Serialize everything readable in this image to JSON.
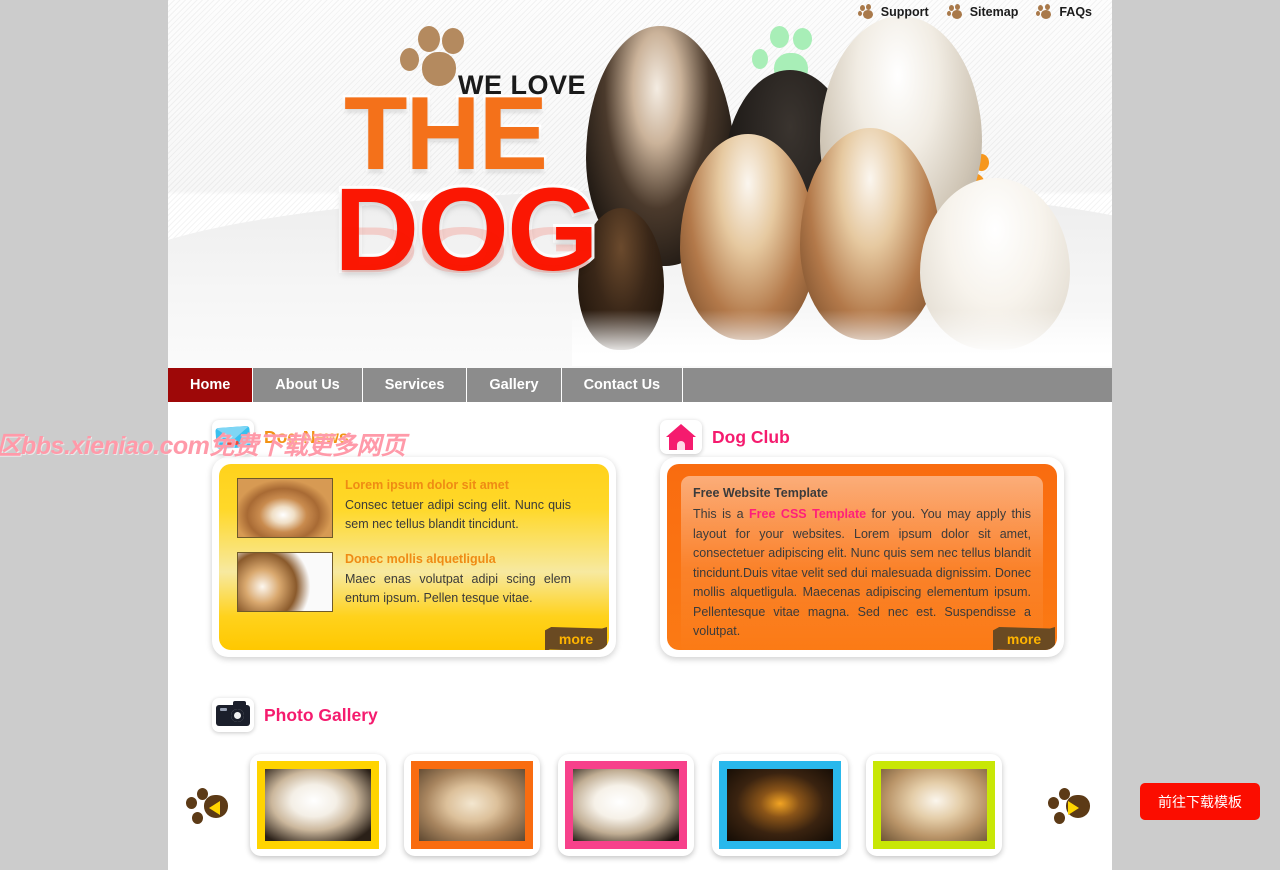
{
  "top_links": [
    {
      "label": "Support",
      "icon": "paw-icon"
    },
    {
      "label": "Sitemap",
      "icon": "paw-icon"
    },
    {
      "label": "FAQs",
      "icon": "paw-icon"
    }
  ],
  "logo": {
    "tagline": "WE LOVE",
    "word1": "THE",
    "word2": "DOG",
    "reflection": "DOG",
    "paw_color": "#b48a5f",
    "word1_color": "#f4711a",
    "word2_color": "#fb1703"
  },
  "hero": {
    "paws": [
      {
        "name": "paw-green",
        "color": "#a8eeb7"
      },
      {
        "name": "paw-orange",
        "color": "#f6971d"
      },
      {
        "name": "paw-purple",
        "color": "#ab49d7"
      }
    ]
  },
  "nav": {
    "items": [
      {
        "label": "Home",
        "active": true
      },
      {
        "label": "About Us",
        "active": false
      },
      {
        "label": "Services",
        "active": false
      },
      {
        "label": "Gallery",
        "active": false
      },
      {
        "label": "Contact Us",
        "active": false
      }
    ],
    "active_color": "#9e0808",
    "bar_color": "#8c8c8c"
  },
  "news": {
    "title": "Dog News",
    "icon": "mail-icon",
    "more_label": "more",
    "items": [
      {
        "headline": "Lorem ipsum dolor sit amet",
        "text": "Consec tetuer adipi scing elit. Nunc quis sem nec tellus blandit tincidunt.",
        "thumb": "corgi-photo"
      },
      {
        "headline": "Donec mollis alquetligula",
        "text": "Maec enas volutpat adipi scing elem entum ipsum. Pellen tesque vitae.",
        "thumb": "beagle-puppies-photo"
      }
    ]
  },
  "club": {
    "title": "Dog Club",
    "icon": "house-icon",
    "more_label": "more",
    "heading": "Free Website Template",
    "body_part1": "This is a ",
    "body_link": "Free CSS Template",
    "body_part2": " for you. You may apply this layout for your websites. Lorem ipsum dolor sit amet, consectetuer adipiscing elit. Nunc quis sem nec tellus blandit tincidunt.Duis vitae velit sed dui malesuada dignissim. Donec mollis alquetligula. Maecenas adipiscing elementum ipsum. Pellentesque vitae magna. Sed nec est. Suspendisse a volutpat.",
    "link_color": "#ff1f7a"
  },
  "gallery": {
    "title": "Photo Gallery",
    "icon": "camera-icon",
    "prev_label": "previous",
    "next_label": "next",
    "thumbs": [
      {
        "name": "white-poodle-1",
        "frame_color": "#ffd400",
        "photo": "ph-poodle-a"
      },
      {
        "name": "apricot-poodle",
        "frame_color": "#f96c10",
        "photo": "ph-poodle-b"
      },
      {
        "name": "white-poodle-2",
        "frame_color": "#f7418b",
        "photo": "ph-poodle-c"
      },
      {
        "name": "chihuahua",
        "frame_color": "#29b8ec",
        "photo": "ph-chi"
      },
      {
        "name": "poodle-toy",
        "frame_color": "#c8e706",
        "photo": "ph-poodle-d"
      }
    ]
  },
  "watermark": "访问血鸟社区bbs.xieniao.com免费下载更多网页",
  "cta": {
    "label": "前往下载模板",
    "color": "#fb0d00"
  }
}
